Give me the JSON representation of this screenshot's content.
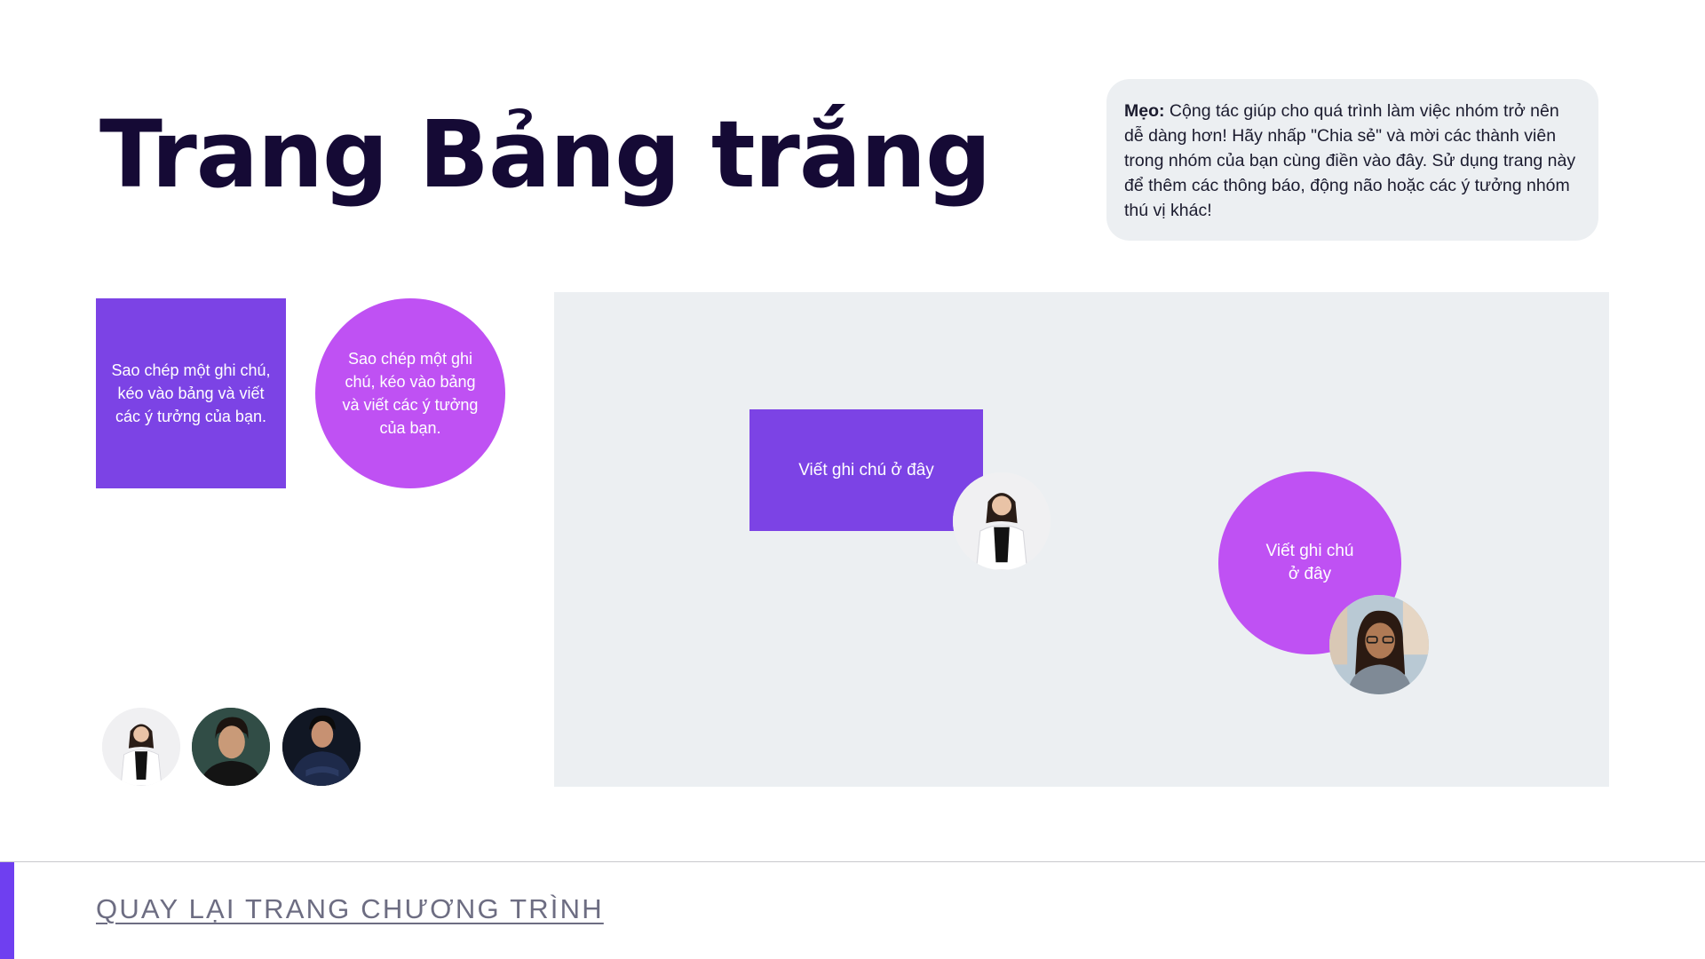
{
  "page": {
    "title": "Trang Bảng trắng"
  },
  "tip": {
    "label": "Mẹo:",
    "text": " Cộng tác giúp cho quá trình làm việc nhóm trở nên dễ dàng hơn! Hãy nhấp \"Chia sẻ\" và mời các thành viên trong nhóm của bạn cùng điền vào đây. Sử dụng trang này để thêm các thông báo, động não hoặc các ý tưởng nhóm thú vị khác!"
  },
  "sample_notes": {
    "square_text": "Sao chép một ghi chú, kéo vào bảng và viết các ý tưởng của bạn.",
    "circle_text": "Sao chép một ghi chú, kéo vào bảng và viết các ý tưởng của bạn."
  },
  "board": {
    "square_note_text": "Viết ghi chú ở đây",
    "circle_note_text": "Viết ghi chú ở đây"
  },
  "team_avatars": [
    {
      "name": "woman-white-blazer-avatar"
    },
    {
      "name": "man-dark-green-avatar"
    },
    {
      "name": "man-navy-shirt-avatar"
    }
  ],
  "footer": {
    "back_link": "QUAY LẠI TRANG CHƯƠNG TRÌNH"
  },
  "colors": {
    "title": "#150a35",
    "note_purple": "#7c43e5",
    "note_magenta": "#bf51f3",
    "board_bg": "#eceff2",
    "accent": "#6f3ff0",
    "link": "#6d6d82"
  }
}
